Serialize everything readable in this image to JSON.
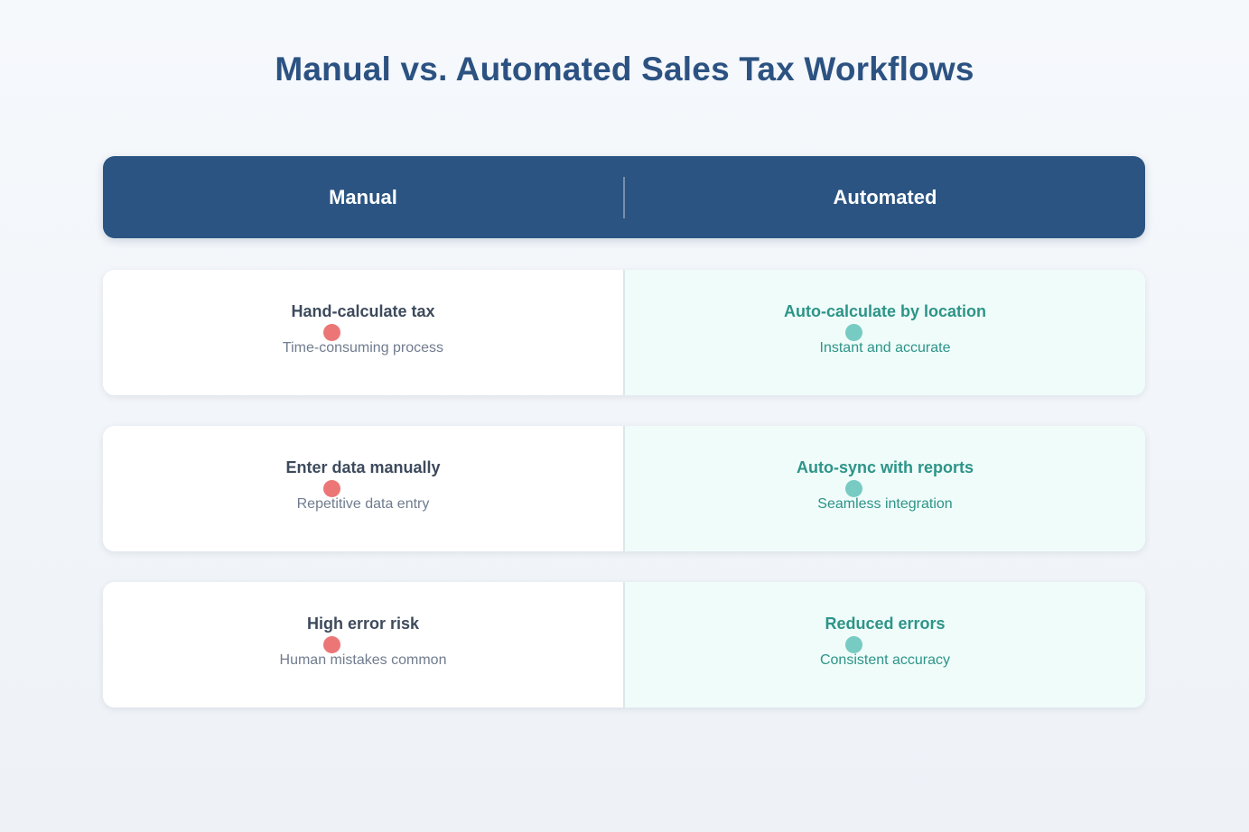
{
  "title": "Manual vs. Automated Sales Tax Workflows",
  "header": {
    "manual": "Manual",
    "automated": "Automated"
  },
  "colors": {
    "header_bg": "#2b5482",
    "title": "#2c5282",
    "manual_dot": "#ec7676",
    "auto_dot": "#77cbc3",
    "auto_text": "#2d9488",
    "auto_bg": "#effcfa"
  },
  "rows": [
    {
      "manual": {
        "title": "Hand-calculate tax",
        "subtitle": "Time-consuming process"
      },
      "automated": {
        "title": "Auto-calculate by location",
        "subtitle": "Instant and accurate"
      }
    },
    {
      "manual": {
        "title": "Enter data manually",
        "subtitle": "Repetitive data entry"
      },
      "automated": {
        "title": "Auto-sync with reports",
        "subtitle": "Seamless integration"
      }
    },
    {
      "manual": {
        "title": "High error risk",
        "subtitle": "Human mistakes common"
      },
      "automated": {
        "title": "Reduced errors",
        "subtitle": "Consistent accuracy"
      }
    }
  ]
}
